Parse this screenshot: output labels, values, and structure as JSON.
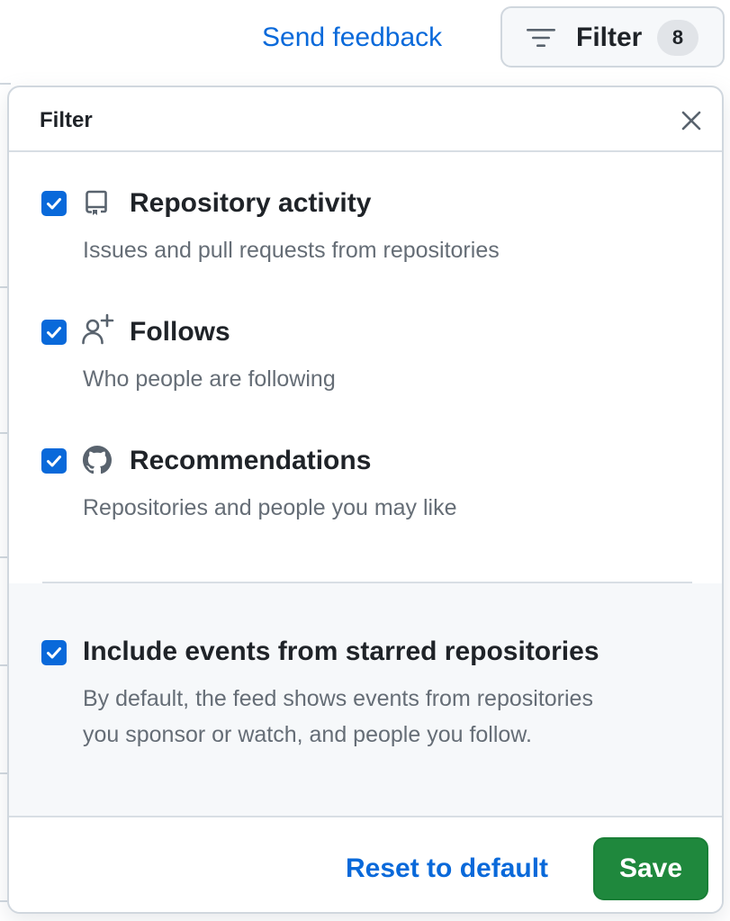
{
  "topbar": {
    "send_feedback": "Send feedback",
    "filter_label": "Filter",
    "filter_count": "8"
  },
  "panel": {
    "title": "Filter",
    "options": [
      {
        "label": "Repository activity",
        "description": "Issues and pull requests from repositories",
        "checked": true,
        "icon": "repo-icon"
      },
      {
        "label": "Follows",
        "description": "Who people are following",
        "checked": true,
        "icon": "person-add-icon"
      },
      {
        "label": "Recommendations",
        "description": "Repositories and people you may like",
        "checked": true,
        "icon": "github-mark-icon"
      }
    ],
    "starred": {
      "label": "Include events from starred repositories",
      "description_line1": "By default, the feed shows events from repositories",
      "description_line2": "you sponsor or watch, and people you follow.",
      "checked": true
    },
    "footer": {
      "reset_label": "Reset to default",
      "save_label": "Save"
    }
  },
  "colors": {
    "accent": "#0969da",
    "save_green": "#1f883d",
    "muted_text": "#656d76"
  }
}
